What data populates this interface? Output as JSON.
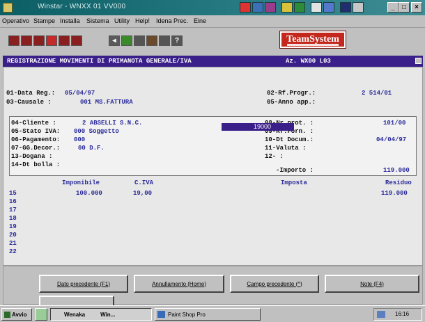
{
  "window": {
    "title": "Winstar - WNXX 01 VV000"
  },
  "menu": [
    "Operativo",
    "Stampe",
    "Installa",
    "Sistema",
    "Utility",
    "Help!",
    "Idena Prec.",
    "Eine"
  ],
  "brand": {
    "logo": "TeamSystem"
  },
  "form": {
    "title": "REGISTRAZIONE MOVIMENTI DI PRIMANOTA GENERALE/IVA",
    "code": "Az. WX00 L03"
  },
  "header_fields": {
    "data_reg_label": "01-Data Reg.:",
    "data_reg_value": "05/04/97",
    "causale_label": "03-Causale  :",
    "causale_value": "001 MS.FATTURA",
    "rif_progr_label": "02-Rf.Progr.:",
    "rif_progr_value": "2  514/01",
    "anno_app_label": "05-Anno app.:",
    "anno_app_value": ""
  },
  "box_fields": {
    "cliente_label": "04-Cliente  :",
    "cliente_value": "2 ABSELLI S.N.C.",
    "stato_iva_label": "05-Stato IVA:",
    "stato_iva_value": "000 Soggetto",
    "pagamento_label": "06-Pagamento:",
    "pagamento_value": "000",
    "gg_decor_label": "07-GG.Decor.:",
    "gg_decor_value": "00 D.F.",
    "dogana_label": "13-Dogana   :",
    "dt_bolla_label": "14-Dt bolla :",
    "nr_prot_label": "08-Nr prot. :",
    "nr_prot_value": "101/00",
    "rif_forn_label": "09-Rf.Forn. :",
    "dt_docum_label": "10-Dt Docum.:",
    "dt_docum_value": "04/04/97",
    "valuta_label": "11-Valuta   :",
    "field12_label": "12-        :",
    "importo_label": "-Importo  :",
    "importo_value": "119.000"
  },
  "grid": {
    "headers": [
      "Imponibile",
      "C.IVA",
      "Imposta",
      "Residuo"
    ],
    "row_numbers": [
      "15",
      "16",
      "17",
      "18",
      "19",
      "20",
      "21",
      "22"
    ],
    "first_row": {
      "imponibile": "100.000",
      "c_iva": "19,00",
      "imposta": "19000",
      "residuo": "119.000"
    }
  },
  "buttons": {
    "prev_field": "Dato precedente (F1)",
    "cancel": "Annullamento (Home)",
    "prev_page": "Campo precedente (^)",
    "notes": "Note (F4)"
  },
  "taskbar": {
    "start": "Avvio",
    "task1": "Wenaka",
    "task1b": "Win...",
    "task2": "Paint Shop Pro",
    "clock": "16:16"
  },
  "colors": {
    "form_header": "#3a1f8a",
    "field_values": "#2a2a9a",
    "title_bar": "#0b5e64",
    "logo": "#c4281c"
  }
}
